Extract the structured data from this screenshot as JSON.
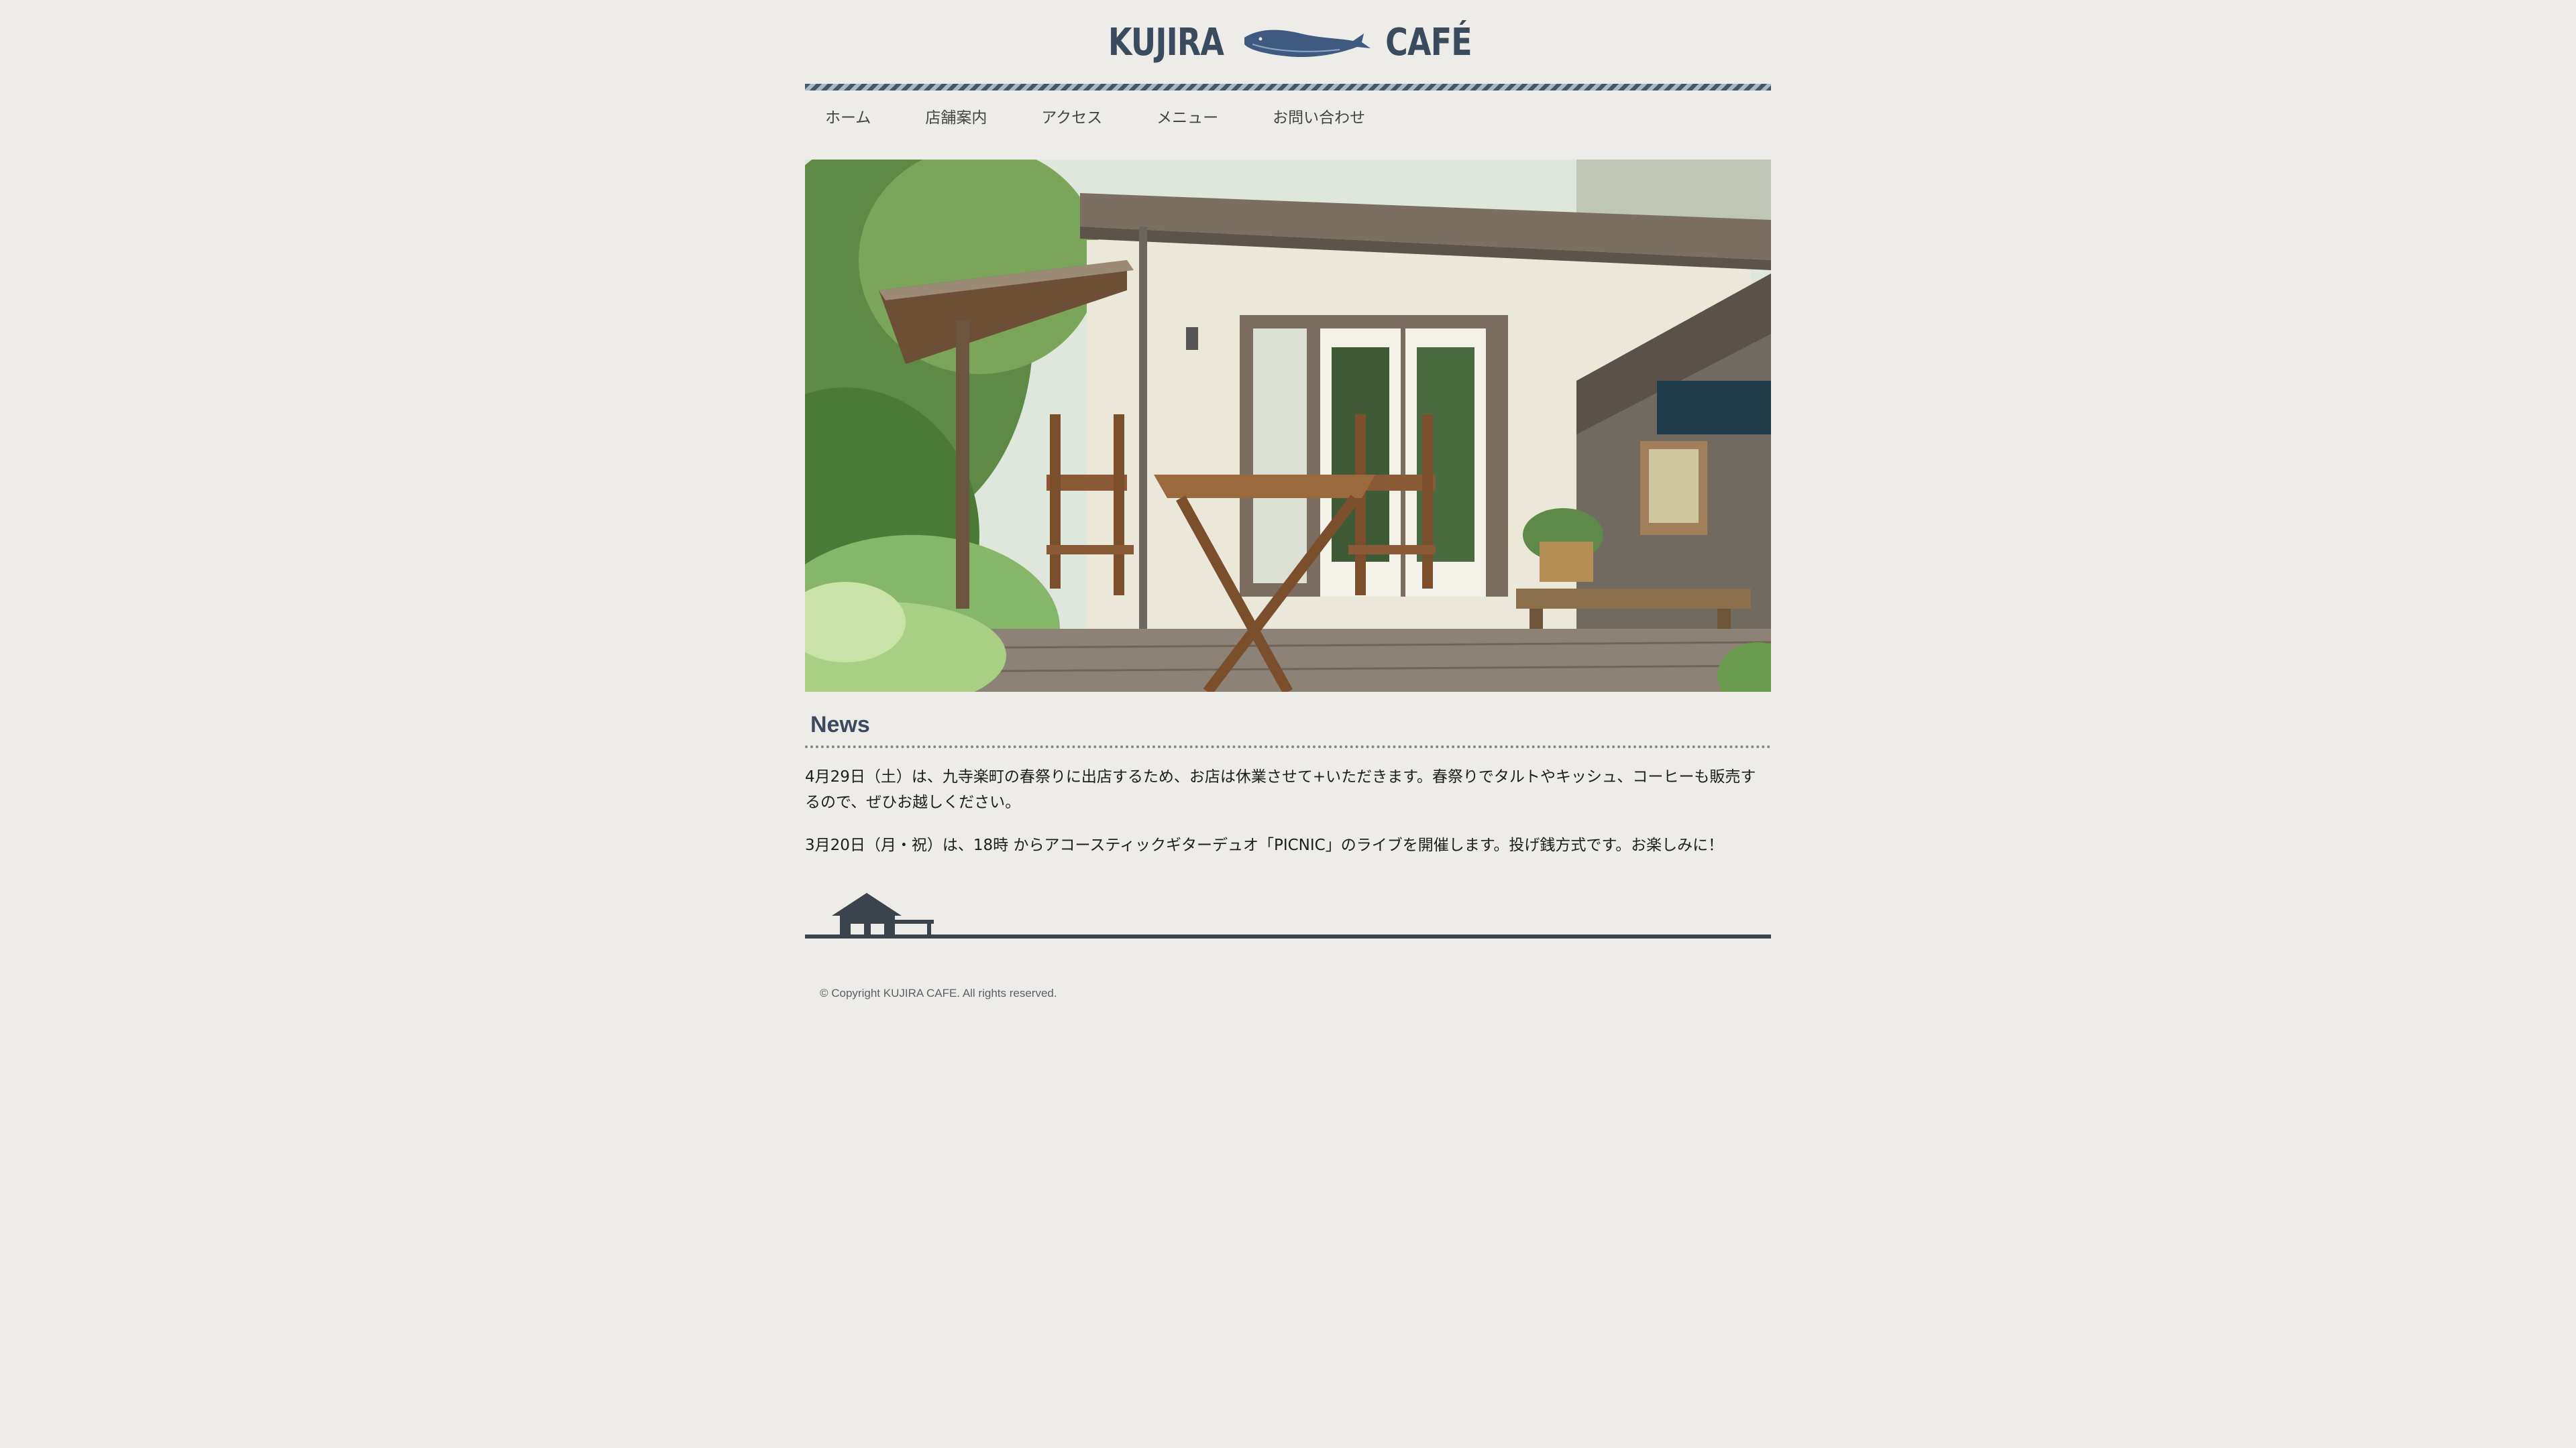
{
  "header": {
    "logo_left": "KUJIRA",
    "logo_right": "CAFÉ",
    "logo_icon": "whale-icon"
  },
  "nav": {
    "items": [
      {
        "label": "ホーム"
      },
      {
        "label": "店舗案内"
      },
      {
        "label": "アクセス"
      },
      {
        "label": "メニュー"
      },
      {
        "label": "お問い合わせ"
      }
    ]
  },
  "hero": {
    "image": "cafe-terrace-photo"
  },
  "news": {
    "title": "News",
    "items": [
      "4月29日（土）は、九寺楽町の春祭りに出店するため、お店は休業させて+いただきます。春祭りでタルトやキッシュ、コーヒーも販売するので、ぜひお越しください。",
      "3月20日（月・祝）は、18時 からアコースティックギターデュオ「PICNIC」のライブを開催します。投げ銭方式です。お楽しみに！"
    ]
  },
  "footer": {
    "icon": "house-icon",
    "copyright": "© Copyright KUJIRA CAFE. All rights reserved."
  },
  "colors": {
    "background": "#edece8",
    "brand": "#3b4b5e",
    "stripe_dark": "#42566d",
    "stripe_light": "#a9b8c8",
    "footer_line": "#3b434c"
  }
}
